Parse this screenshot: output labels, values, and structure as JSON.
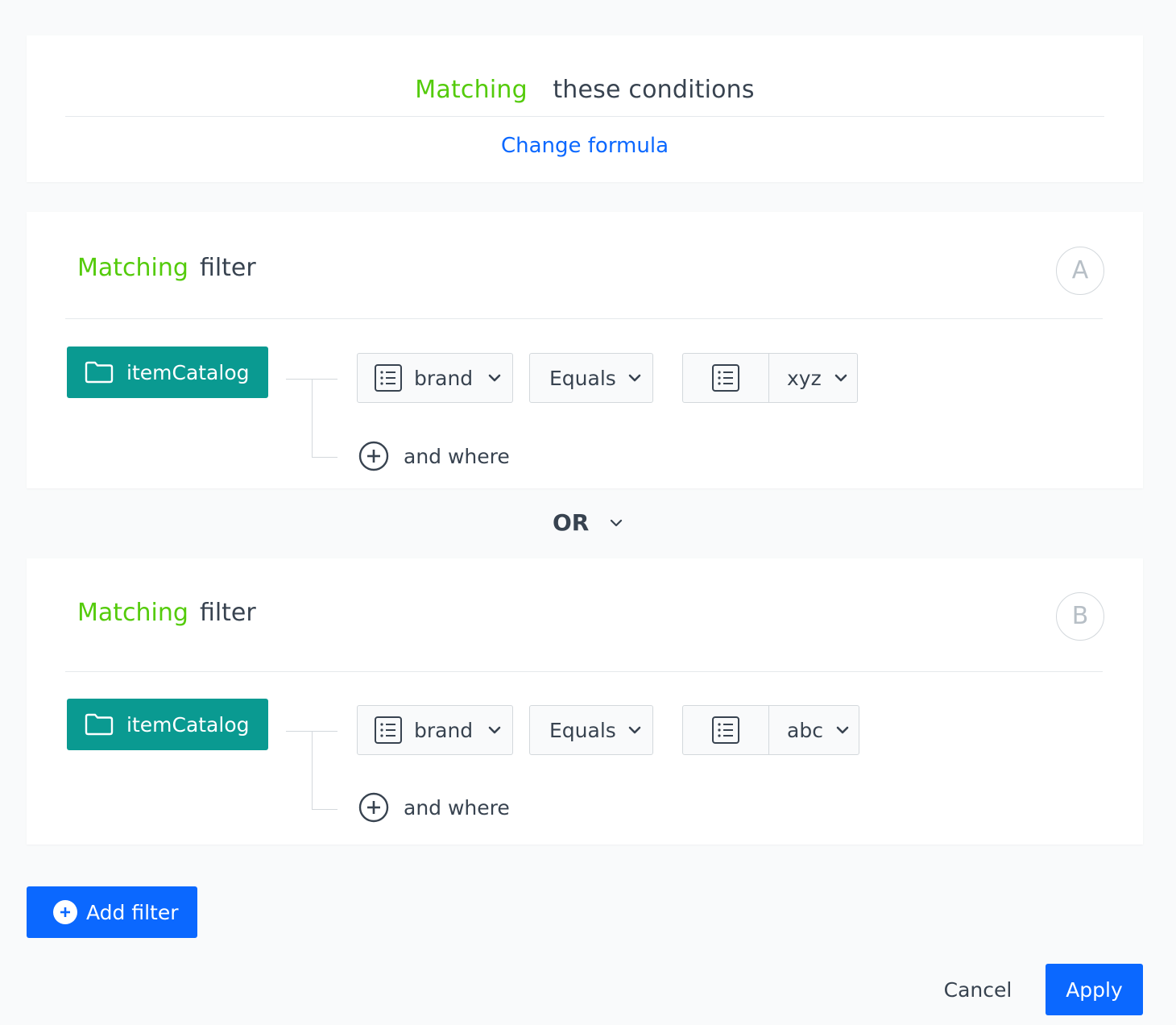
{
  "header": {
    "matching": "Matching",
    "conditions": "these conditions",
    "change_formula": "Change formula"
  },
  "filters": [
    {
      "matching": "Matching",
      "filter": "filter",
      "letter": "A",
      "catalog": "itemCatalog",
      "attribute": "brand",
      "operator": "Equals",
      "value": "xyz",
      "and_where": "and where"
    },
    {
      "matching": "Matching",
      "filter": "filter",
      "letter": "B",
      "catalog": "itemCatalog",
      "attribute": "brand",
      "operator": "Equals",
      "value": "abc",
      "and_where": "and where"
    }
  ],
  "logic": {
    "operator": "OR"
  },
  "actions": {
    "add_filter": "Add filter",
    "cancel": "Cancel",
    "apply": "Apply"
  },
  "colors": {
    "green": "#54cb0b",
    "blue": "#0b68ff",
    "teal": "#0a9a91",
    "text": "#384350"
  }
}
